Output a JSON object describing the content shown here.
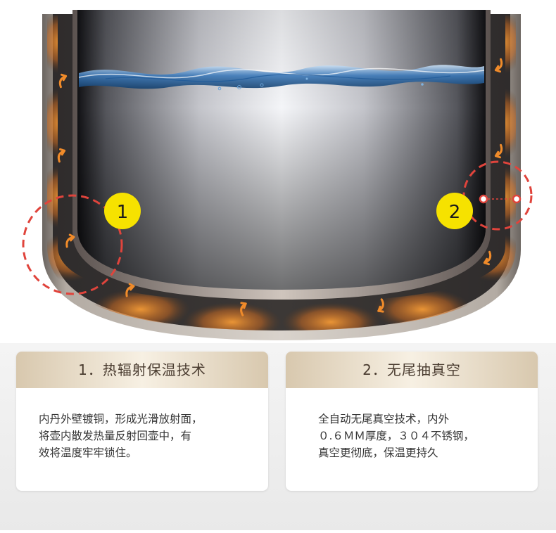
{
  "badges": [
    "1",
    "2"
  ],
  "features": [
    {
      "title": "1．热辐射保温技术",
      "lines": [
        "内丹外壁镀铜，形成光滑放射面，",
        "将壶内散发热量反射回壶中，有",
        "效将温度牢牢锁住。"
      ]
    },
    {
      "title": "2．无尾抽真空",
      "lines": [
        "全自动无尾真空技术，内外",
        "０.６ＭＭ厚度，３０４不锈钢，",
        "真空更彻底，保温更持久"
      ]
    }
  ],
  "colors": {
    "badge": "#f6e200",
    "callout": "#e0443c",
    "heat": "#e8832a",
    "water": "#3b78b8",
    "header_gold": "#d8c8ae"
  },
  "icons": [
    "heat-flow-arrow-icon"
  ]
}
